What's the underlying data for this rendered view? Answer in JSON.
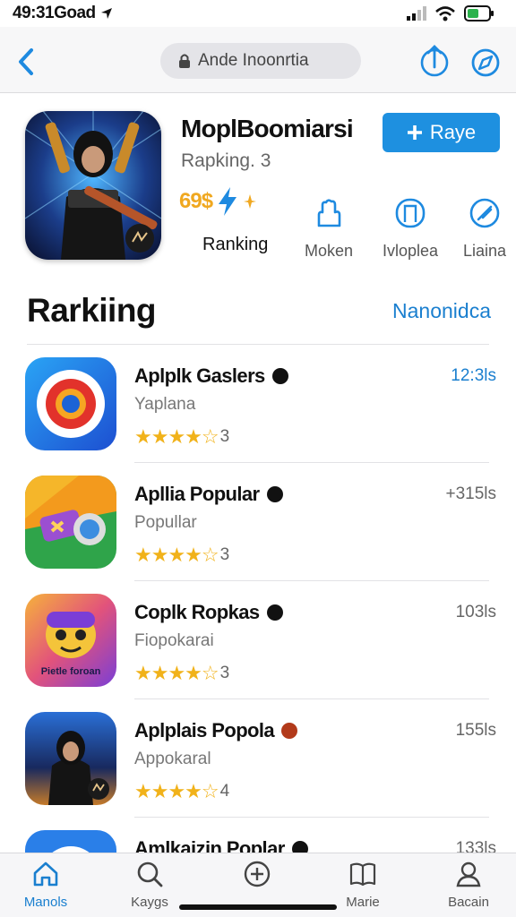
{
  "status": {
    "time": "49:31Goad"
  },
  "nav": {
    "url": "Ande Inoonrtia"
  },
  "hero": {
    "title": "MoplBoomiarsi",
    "subtitle": "Rapking. 3",
    "button_label": "Raye",
    "rating_value": "69$",
    "rating_label": "Ranking",
    "metrics": [
      {
        "label": "Moken",
        "icon": "hand-icon"
      },
      {
        "label": "Ivloplea",
        "icon": "bookmark-icon"
      },
      {
        "label": "Liaina",
        "icon": "compass-icon"
      }
    ]
  },
  "section": {
    "title": "Rarkiing",
    "link": "Nanonidca"
  },
  "apps": [
    {
      "name": "Aplplk Gaslers",
      "sub": "Yaplana",
      "stars": "★★★★☆",
      "count": "3",
      "size": "12:3ls",
      "size_color": "#1a7fcf"
    },
    {
      "name": "Apllia Popular",
      "sub": "Popullar",
      "stars": "★★★★☆",
      "count": "3",
      "size": "+315ls",
      "size_color": "#666666"
    },
    {
      "name": "Coplk Ropkas",
      "sub": "Fiopokarai",
      "stars": "★★★★☆",
      "count": "3",
      "size": "103ls",
      "size_color": "#666666",
      "icon_text": "Pietle foroan"
    },
    {
      "name": "Aplplais Popola",
      "sub": "Appokaral",
      "stars": "★★★★☆",
      "count": "4",
      "size": "155ls",
      "size_color": "#666666"
    },
    {
      "name": "Amlkaizin Poplar",
      "sub": "",
      "stars": "",
      "count": "",
      "size": "133ls",
      "size_color": "#666666"
    }
  ],
  "tabs": [
    {
      "label": "Manols",
      "icon": "home-icon",
      "active": true
    },
    {
      "label": "Kaygs",
      "icon": "search-icon",
      "active": false
    },
    {
      "label": "",
      "icon": "plus-circle-icon",
      "active": false
    },
    {
      "label": "Marie",
      "icon": "book-icon",
      "active": false
    },
    {
      "label": "Bacain",
      "icon": "person-icon",
      "active": false
    }
  ],
  "colors": {
    "accent": "#1e90e0",
    "star": "#f1b21a",
    "link": "#1a7fcf"
  }
}
